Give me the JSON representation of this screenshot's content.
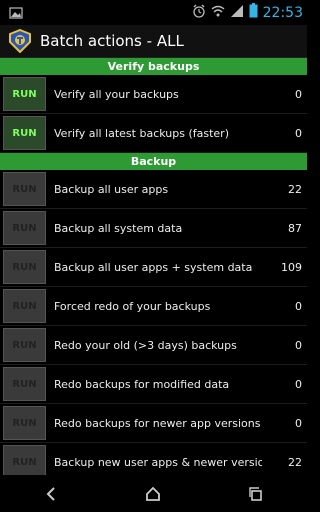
{
  "status_bar": {
    "time": "22:53",
    "icons": [
      "image-notification-icon",
      "alarm-icon",
      "wifi-icon",
      "signal-icon",
      "battery-icon"
    ]
  },
  "action_bar": {
    "title": "Batch actions - ALL",
    "logo_icon": "titanium-backup-logo"
  },
  "sections": [
    {
      "title": "Verify backups",
      "items": [
        {
          "button": "RUN",
          "label": "Verify all your backups",
          "count": "0"
        },
        {
          "button": "RUN",
          "label": "Verify all latest backups (faster)",
          "count": "0"
        }
      ]
    },
    {
      "title": "Backup",
      "items": [
        {
          "button": "RUN",
          "label": "Backup all user apps",
          "count": "22"
        },
        {
          "button": "RUN",
          "label": "Backup all system data",
          "count": "87"
        },
        {
          "button": "RUN",
          "label": "Backup all user apps + system data",
          "count": "109"
        },
        {
          "button": "RUN",
          "label": "Forced redo of your backups",
          "count": "0"
        },
        {
          "button": "RUN",
          "label": "Redo your old (>3 days) backups",
          "count": "0"
        },
        {
          "button": "RUN",
          "label": "Redo backups for modified data",
          "count": "0"
        },
        {
          "button": "RUN",
          "label": "Redo backups for newer app versions",
          "count": "0"
        },
        {
          "button": "RUN",
          "label": "Backup new user apps & newer versions",
          "count": "22"
        }
      ]
    }
  ],
  "colors": {
    "section_header_bg": "#2e9a34",
    "enabled_run_text": "#7dff5f",
    "disabled_run_text": "#222222",
    "accent_clock": "#33b5e5"
  },
  "nav_bar": {
    "icons": [
      "back-icon",
      "home-icon",
      "recent-apps-icon"
    ]
  }
}
